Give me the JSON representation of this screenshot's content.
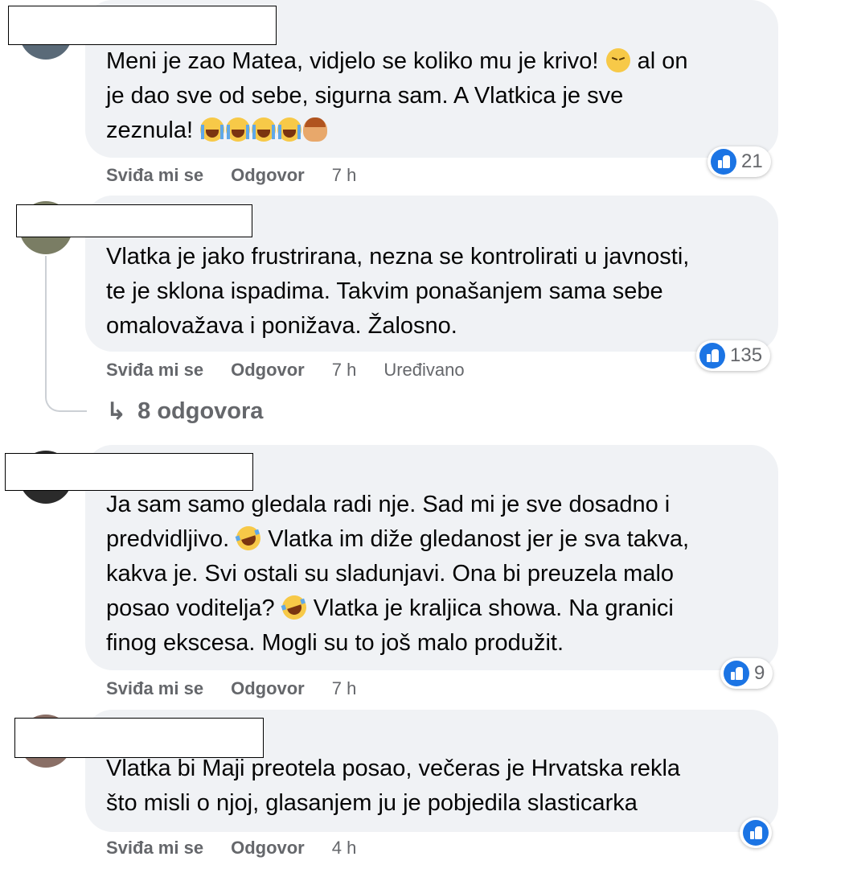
{
  "comments": [
    {
      "lines": [
        "Meni je zao Matea, vidjelo se koliko mu je krivo! ",
        " al on",
        "je dao sve od sebe, sigurna sam. A Vlatkica je sve",
        "zeznula! "
      ],
      "actions": {
        "like": "Sviđa mi se",
        "reply": "Odgovor",
        "time": "7 h",
        "edited": ""
      },
      "reactions": "21"
    },
    {
      "lines": [
        "Vlatka je jako frustrirana, nezna se kontrolirati u javnosti,",
        "te je sklona ispadima. Takvim ponašanjem sama sebe",
        "omalovažava i ponižava. Žalosno."
      ],
      "actions": {
        "like": "Sviđa mi se",
        "reply": "Odgovor",
        "time": "7 h",
        "edited": "Uređivano"
      },
      "reactions": "135",
      "replies_label": "8 odgovora"
    },
    {
      "lines": [
        "Ja sam samo gledala radi nje. Sad mi je sve dosadno i",
        "predvidljivo. ",
        " Vlatka im diže gledanost jer je sva takva,",
        "kakva je. Svi ostali su sladunjavi. Ona bi preuzela malo",
        "posao voditelja? ",
        " Vlatka je kraljica showa. Na granici",
        "finog ekscesa. Mogli su to još malo produžit."
      ],
      "actions": {
        "like": "Sviđa mi se",
        "reply": "Odgovor",
        "time": "7 h",
        "edited": ""
      },
      "reactions": "9"
    },
    {
      "lines": [
        "Vlatka bi Maji preotela posao, večeras je Hrvatska rekla",
        "što misli o njoj, glasanjem ju je pobjedila slasticarka"
      ],
      "actions": {
        "like": "Sviđa mi se",
        "reply": "Odgovor",
        "time": "4 h",
        "edited": ""
      },
      "reactions": ""
    }
  ],
  "icons": {
    "like": "like-thumb-icon",
    "reply_arrow": "reply-arrow-icon",
    "emoji_pensive": "pensive-face-icon",
    "emoji_cry": "loudly-crying-face-icon",
    "emoji_facepalm": "woman-facepalming-icon",
    "emoji_laugh": "rolling-laughing-face-icon"
  },
  "colors": {
    "bubble": "#f0f2f5",
    "meta_text": "#65676b",
    "like_blue": "#1b74e4"
  }
}
